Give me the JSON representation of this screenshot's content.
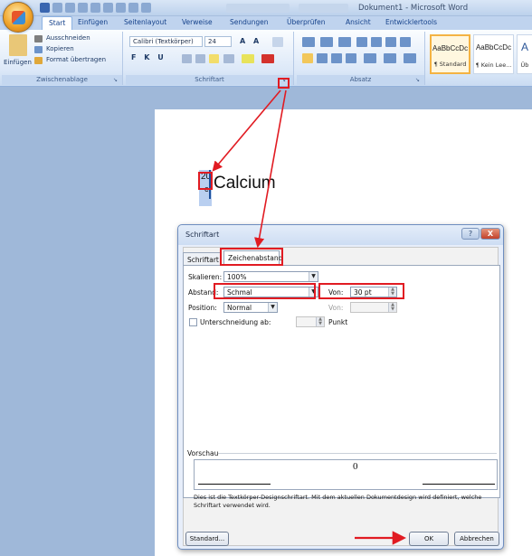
{
  "window": {
    "title": "Dokument1 - Microsoft Word"
  },
  "ribbon": {
    "tabs": [
      {
        "label": "Start"
      },
      {
        "label": "Einfügen"
      },
      {
        "label": "Seitenlayout"
      },
      {
        "label": "Verweise"
      },
      {
        "label": "Sendungen"
      },
      {
        "label": "Überprüfen"
      },
      {
        "label": "Ansicht"
      },
      {
        "label": "Entwicklertools"
      }
    ],
    "clipboard": {
      "paste_label": "Einfügen",
      "cut_label": "Ausschneiden",
      "copy_label": "Kopieren",
      "format_painter_label": "Format übertragen",
      "group_label": "Zwischenablage"
    },
    "font": {
      "font_name": "Calibri (Textkörper)",
      "font_size": "24",
      "group_label": "Schriftart"
    },
    "paragraph": {
      "group_label": "Absatz"
    },
    "styles": {
      "items": [
        {
          "sample": "AaBbCcDc",
          "name": "¶ Standard"
        },
        {
          "sample": "AaBbCcDc",
          "name": "¶ Kein Lee..."
        },
        {
          "sample": "A",
          "name": "Üb"
        }
      ]
    }
  },
  "document": {
    "superscript": "20",
    "subscript": "c",
    "word": "Calcium"
  },
  "dialog": {
    "title": "Schriftart",
    "help_glyph": "?",
    "close_glyph": "X",
    "tabs": [
      {
        "label": "Schriftart"
      },
      {
        "label": "Zeichenabstand"
      }
    ],
    "scale_label": "Skalieren:",
    "scale_value": "100%",
    "spacing_label": "Abstand:",
    "spacing_value": "Schmal",
    "spacing_by_label": "Von:",
    "spacing_by_value": "30 pt",
    "position_label": "Position:",
    "position_value": "Normal",
    "position_by_label": "Von:",
    "kerning_label": "Unterschneidung ab:",
    "kerning_unit": "Punkt",
    "preview_label": "Vorschau",
    "preview_char": "0",
    "note": "Dies ist die Textkörper-Designschriftart. Mit dem aktuellen Dokumentdesign wird definiert, welche Schriftart verwendet wird.",
    "default_button": "Standard...",
    "ok_button": "OK",
    "cancel_button": "Abbrechen"
  },
  "colors": {
    "annotation": "#e11b22",
    "ribbon_bg": "#dde9f8",
    "dialog_bg": "#e7eefa"
  }
}
